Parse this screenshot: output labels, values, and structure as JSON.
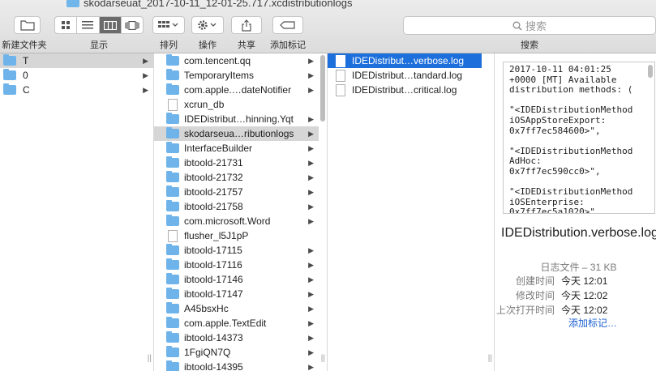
{
  "window": {
    "title": "skodarseuat_2017-10-11_12-01-25.717.xcdistributionlogs"
  },
  "toolbar": {
    "new_folder": {
      "label": "新建文件夹",
      "icon": "new-folder-icon"
    },
    "view": {
      "label": "显示",
      "modes": [
        "icon",
        "list",
        "column",
        "cover-flow"
      ],
      "selected": "column"
    },
    "arrange": {
      "label": "排列"
    },
    "action": {
      "label": "操作"
    },
    "share": {
      "label": "共享"
    },
    "tags": {
      "label": "添加标记"
    },
    "search": {
      "placeholder": "搜索",
      "label": "搜索"
    }
  },
  "columns": {
    "col1": {
      "items": [
        {
          "name": "T",
          "kind": "folder",
          "selected": true
        },
        {
          "name": "0",
          "kind": "folder",
          "selected": false
        },
        {
          "name": "C",
          "kind": "folder",
          "selected": false
        }
      ]
    },
    "col2": {
      "items": [
        {
          "name": "com.tencent.qq",
          "kind": "folder",
          "arrow": true
        },
        {
          "name": "TemporaryItems",
          "kind": "folder",
          "arrow": true
        },
        {
          "name": "com.apple.…dateNotifier",
          "kind": "folder",
          "arrow": true
        },
        {
          "name": "xcrun_db",
          "kind": "file",
          "arrow": false
        },
        {
          "name": "IDEDistribut…hinning.Yqt",
          "kind": "folder",
          "arrow": true
        },
        {
          "name": "skodarseua…ributionlogs",
          "kind": "folder",
          "arrow": true,
          "selected": true
        },
        {
          "name": "InterfaceBuilder",
          "kind": "folder",
          "arrow": true
        },
        {
          "name": "ibtoold-21731",
          "kind": "folder",
          "arrow": true
        },
        {
          "name": "ibtoold-21732",
          "kind": "folder",
          "arrow": true
        },
        {
          "name": "ibtoold-21757",
          "kind": "folder",
          "arrow": true
        },
        {
          "name": "ibtoold-21758",
          "kind": "folder",
          "arrow": true
        },
        {
          "name": "com.microsoft.Word",
          "kind": "folder",
          "arrow": true
        },
        {
          "name": "flusher_l5J1pP",
          "kind": "file",
          "arrow": false
        },
        {
          "name": "ibtoold-17115",
          "kind": "folder",
          "arrow": true
        },
        {
          "name": "ibtoold-17116",
          "kind": "folder",
          "arrow": true
        },
        {
          "name": "ibtoold-17146",
          "kind": "folder",
          "arrow": true
        },
        {
          "name": "ibtoold-17147",
          "kind": "folder",
          "arrow": true
        },
        {
          "name": "A45bsxHc",
          "kind": "folder",
          "arrow": true
        },
        {
          "name": "com.apple.TextEdit",
          "kind": "folder",
          "arrow": true
        },
        {
          "name": "ibtoold-14373",
          "kind": "folder",
          "arrow": true
        },
        {
          "name": "1FgiQN7Q",
          "kind": "folder",
          "arrow": true
        },
        {
          "name": "ibtoold-14395",
          "kind": "folder",
          "arrow": true
        }
      ]
    },
    "col3": {
      "items": [
        {
          "name": "IDEDistribut…verbose.log",
          "kind": "file",
          "selected": true
        },
        {
          "name": "IDEDistribut…tandard.log",
          "kind": "file",
          "selected": false
        },
        {
          "name": "IDEDistribut…critical.log",
          "kind": "file",
          "selected": false
        }
      ]
    }
  },
  "preview": {
    "content": "2017-10-11 04:01:25\n+0000 [MT] Available\ndistribution methods: (\n\n\"<IDEDistributionMethod\niOSAppStoreExport:\n0x7ff7ec584600>\",\n\n\"<IDEDistributionMethod\nAdHoc:\n0x7ff7ec590cc0>\",\n\n\"<IDEDistributionMethod\niOSEnterprise:\n0x7ff7ec5a1020>\",",
    "file_name": "IDEDistribution.verbose.log",
    "kind_size": "日志文件 – 31 KB",
    "meta": [
      {
        "key": "创建时间",
        "value": "今天 12:01"
      },
      {
        "key": "修改时间",
        "value": "今天 12:02"
      },
      {
        "key": "上次打开时间",
        "value": "今天 12:02"
      }
    ],
    "add_tags": "添加标记…"
  },
  "colors": {
    "selection_blue": "#1d6fdc",
    "selection_gray": "#d6d6d6",
    "folder_blue": "#6eb4ea",
    "link": "#1a5fd1"
  }
}
